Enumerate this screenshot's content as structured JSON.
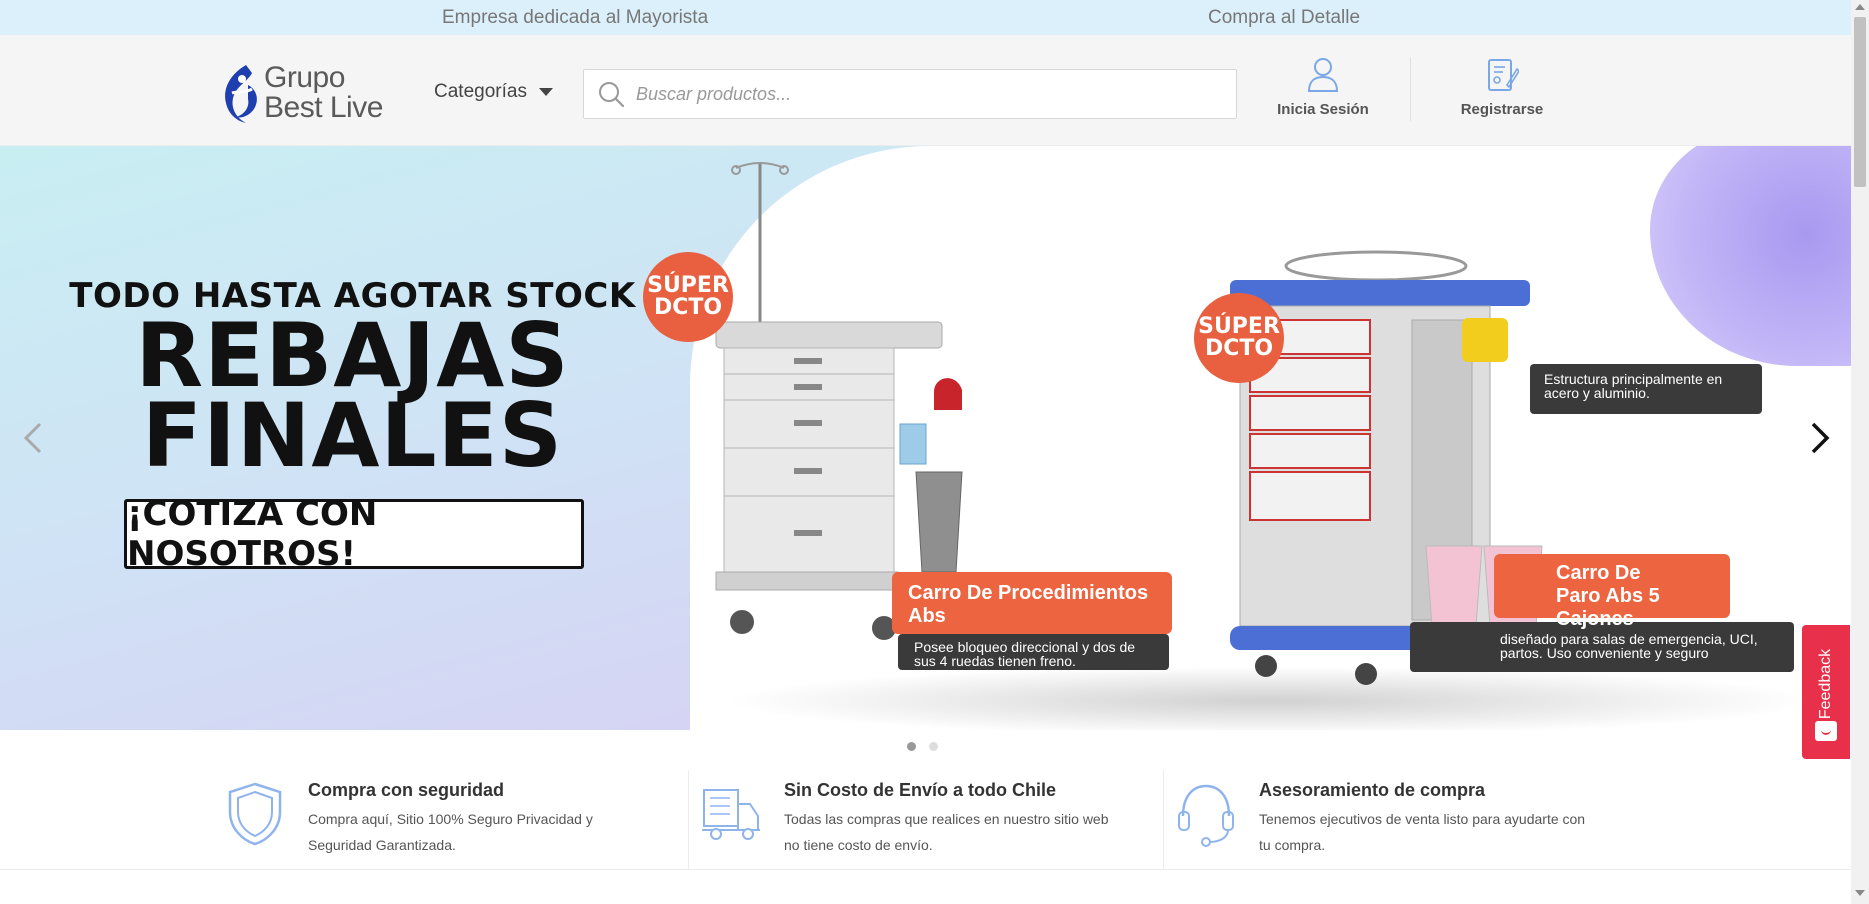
{
  "topbar": {
    "left_text": "Empresa dedicada al Mayorista",
    "right_text": "Compra al Detalle"
  },
  "header": {
    "logo_line1": "Grupo",
    "logo_line2": "Best Live",
    "categories_label": "Categorías",
    "search_placeholder": "Buscar productos...",
    "login_label": "Inicia Sesión",
    "register_label": "Registrarse"
  },
  "banner": {
    "headline_small": "TODO HASTA AGOTAR STOCK",
    "headline_line1": "REBAJAS",
    "headline_line2": "FINALES",
    "cta_text": "¡COTIZA CON NOSOTROS!",
    "badge1_line1": "SÚPER",
    "badge1_line2": "DCTO",
    "badge2_line1": "SÚPER",
    "badge2_line2": "DCTO",
    "product1_name": "Carro De Procedimientos Abs",
    "product1_desc": "Posee bloqueo direccional y dos de sus 4 ruedas tienen freno.",
    "product2_name": "Carro De Paro Abs 5 Cajones",
    "product2_desc": "diseñado para salas de emergencia, UCI, partos. Uso conveniente y seguro",
    "product2_feature": "Estructura principalmente en acero y aluminio.",
    "accent_color": "#ec6440"
  },
  "slider": {
    "slides": 2,
    "active_slide": 1
  },
  "features": [
    {
      "icon": "shield-icon",
      "title": "Compra con seguridad",
      "description": "Compra aquí, Sitio 100% Seguro Privacidad y Seguridad Garantizada."
    },
    {
      "icon": "truck-icon",
      "title": "Sin Costo de Envío a todo Chile",
      "description": "Todas las compras que realices en nuestro sitio web no tiene costo de envío."
    },
    {
      "icon": "headset-icon",
      "title": "Asesoramiento de compra",
      "description": "Tenemos ejecutivos de venta listo para ayudarte con tu compra."
    }
  ],
  "feedback": {
    "label": "Feedback",
    "color": "#e8304a"
  },
  "colors": {
    "topbar_bg": "#dcf0fb",
    "icon_blue": "#7aa7e6"
  }
}
